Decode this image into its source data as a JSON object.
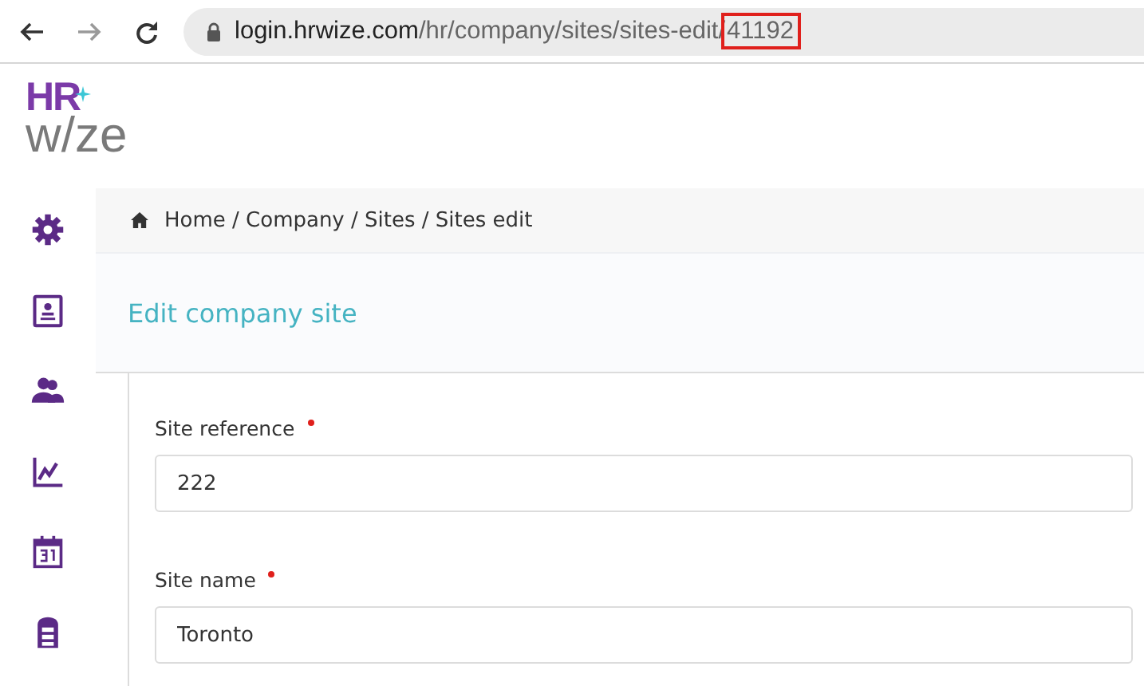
{
  "browser": {
    "nav_buttons": [
      {
        "kind": "back",
        "disabled": false
      },
      {
        "kind": "forward",
        "disabled": true
      },
      {
        "kind": "reload",
        "disabled": false
      }
    ],
    "address_bar": {
      "host": "login.hrwize.com",
      "path": "/hr/company/sites/sites-edit/",
      "highlighted_segment": "41192"
    }
  },
  "logo": {
    "top": "HR",
    "bottom": "w/ze"
  },
  "sidebar": {
    "items": [
      {
        "kind": "settings"
      },
      {
        "kind": "contact"
      },
      {
        "kind": "people"
      },
      {
        "kind": "chart"
      },
      {
        "kind": "calendar"
      },
      {
        "kind": "cabinet"
      }
    ]
  },
  "breadcrumb": "Home / Company / Sites / Sites edit",
  "page_title": "Edit company site",
  "fields": [
    {
      "label": "Site reference",
      "required": true,
      "value": "222"
    },
    {
      "label": "Site name",
      "required": true,
      "value": "Toronto"
    }
  ]
}
